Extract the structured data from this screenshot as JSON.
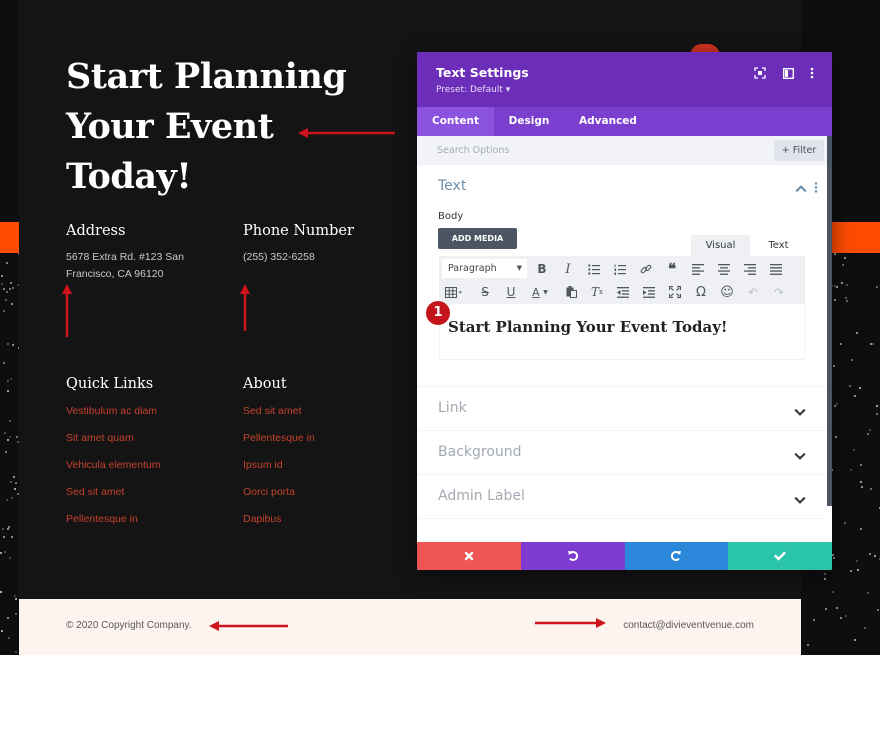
{
  "page": {
    "hero_title": "Start Planning Your Event Today!",
    "address": {
      "heading": "Address",
      "text": "5678 Extra Rd. #123 San Francisco, CA 96120"
    },
    "phone": {
      "heading": "Phone Number",
      "text": "(255) 352-6258"
    },
    "quick_links": {
      "heading": "Quick Links",
      "items": [
        "Vestibulum ac diam",
        "Sit amet quam",
        "Vehicula elementum",
        "Sed sit amet",
        "Pellentesque in"
      ]
    },
    "about": {
      "heading": "About",
      "items": [
        "Sed sit amet",
        "Pellentesque in",
        "Ipsum id",
        "Oorci porta",
        "Dapibus"
      ]
    },
    "footer": {
      "copyright": "© 2020 Copyright Company.",
      "email": "contact@divieventvenue.com"
    }
  },
  "modal": {
    "title": "Text Settings",
    "preset": "Preset: Default ▾",
    "header_icons": [
      "focus-icon",
      "split-view-icon",
      "more-options-icon"
    ],
    "tabs": [
      {
        "label": "Content",
        "active": true
      },
      {
        "label": "Design",
        "active": false
      },
      {
        "label": "Advanced",
        "active": false
      }
    ],
    "search_placeholder": "Search Options",
    "filter_label": "+ Filter",
    "text_section": {
      "title": "Text",
      "body_label": "Body",
      "add_media_label": "ADD MEDIA",
      "mode_tabs": [
        "Visual",
        "Text"
      ],
      "format_select": "Paragraph",
      "editor_content": "Start Planning Your Event Today!"
    },
    "toggles": [
      {
        "label": "Link"
      },
      {
        "label": "Background"
      },
      {
        "label": "Admin Label"
      }
    ],
    "badge_number": "1",
    "colors": {
      "header": "#6c2eb9",
      "tabs": "#7b3fd0",
      "discard": "#ef5555",
      "undo": "#7d3bcf",
      "redo": "#2b87da",
      "save": "#29c4a9"
    }
  },
  "accent_colors": {
    "orange": "#fe4b00",
    "link_red": "#c4412c",
    "annotation_arrow": "#d0141b"
  }
}
